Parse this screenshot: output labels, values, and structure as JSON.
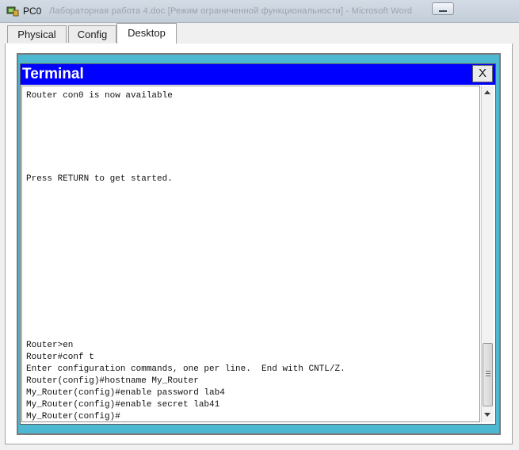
{
  "window": {
    "title": "PC0",
    "background_title": "Лабораторная работа 4.doc [Режим ограниченной функциональности] - Microsoft Word"
  },
  "tabs": [
    {
      "label": "Physical",
      "active": false
    },
    {
      "label": "Config",
      "active": false
    },
    {
      "label": "Desktop",
      "active": true
    }
  ],
  "terminal": {
    "title": "Terminal",
    "close_label": "X",
    "lines": [
      "Router con0 is now available",
      "Press RETURN to get started.",
      "Router>en",
      "Router#conf t",
      "Enter configuration commands, one per line.  End with CNTL/Z.",
      "Router(config)#hostname My_Router",
      "My_Router(config)#enable password lab4",
      "My_Router(config)#enable secret lab41",
      "My_Router(config)#"
    ]
  },
  "colors": {
    "terminal_header": "#0000ff",
    "desktop_background": "#4cb8d2"
  },
  "icons": {
    "app": "packet-tracer-pc-icon",
    "close": "close-x",
    "scroll_up": "arrow-up",
    "scroll_down": "arrow-down"
  }
}
